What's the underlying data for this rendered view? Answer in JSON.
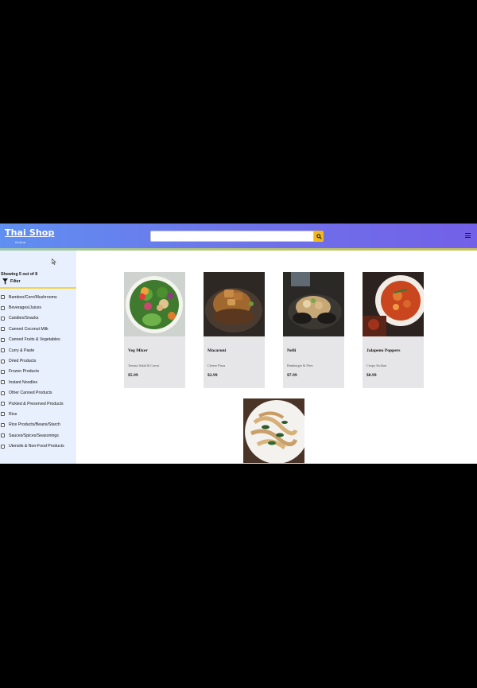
{
  "header": {
    "logo_title": "Thai Shop",
    "logo_sub": "Online",
    "search": {
      "placeholder": "",
      "value": ""
    }
  },
  "sidebar": {
    "showing_text": "Showing 5 out of 8",
    "filter_label": "Filter",
    "categories": [
      "Bamboo/Corn/Mushrooms",
      "Beverages/Juices",
      "Candies/Snacks",
      "Canned Coconut Milk",
      "Canned Fruits & Vegetables",
      "Curry & Paste",
      "Dried Products",
      "Frozen Products",
      "Instant Noodles",
      "Other Canned Products",
      "Pickled & Preserved Products",
      "Rice",
      "Rice Products/Beans/Starch",
      "Sauces/Spices/Seasonings",
      "Utensils & Non-Food Products"
    ]
  },
  "products": [
    {
      "name": "Veg Mixer",
      "description": "Tomato Salad & Carrot",
      "price": "$5.99"
    },
    {
      "name": "Macaroni",
      "description": "Cheese Pizza",
      "price": "$2.99"
    },
    {
      "name": "Nelli",
      "description": "Hamburger & Fries",
      "price": "$7.99"
    },
    {
      "name": "Jalapeno Poppers",
      "description": "Crispy Sicilian",
      "price": "$8.99"
    },
    {
      "name": "",
      "description": "",
      "price": ""
    }
  ],
  "colors": {
    "accent_yellow": "#f3b91b",
    "sidebar_bg": "#e9f0fd",
    "card_bg": "#e6e6e9"
  },
  "icons": [
    "search-icon",
    "menu-icon",
    "filter-icon",
    "cursor-icon"
  ]
}
